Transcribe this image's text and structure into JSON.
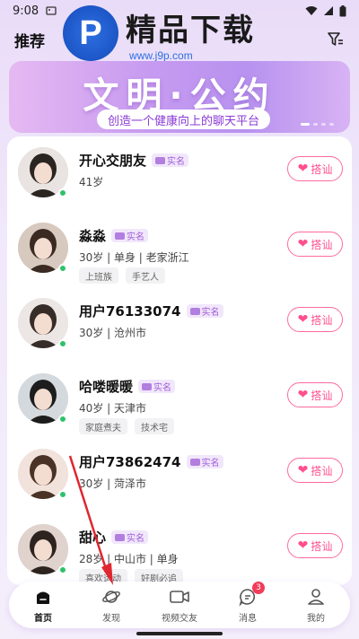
{
  "status_bar": {
    "time": "9:08"
  },
  "header": {
    "title": "推荐"
  },
  "watermark": {
    "logo_letter": "P",
    "title": "精品下载",
    "url": "www.j9p.com"
  },
  "banner": {
    "title": "文明·公约",
    "subtitle": "创造一个健康向上的聊天平台"
  },
  "verified_label": "实名",
  "chat_button_label": "搭讪",
  "users": [
    {
      "name": "开心交朋友",
      "meta": "41岁",
      "tags": []
    },
    {
      "name": "淼淼",
      "meta": "30岁 | 单身 | 老家浙江",
      "tags": [
        "上班族",
        "手艺人"
      ]
    },
    {
      "name": "用户76133074",
      "meta": "30岁 | 沧州市",
      "tags": []
    },
    {
      "name": "哈喽暖暖",
      "meta": "40岁 | 天津市",
      "tags": [
        "家庭煮夫",
        "技术宅"
      ]
    },
    {
      "name": "用户73862474",
      "meta": "30岁 | 菏泽市",
      "tags": []
    },
    {
      "name": "甜心",
      "meta": "28岁 | 中山市 | 单身",
      "tags": [
        "喜欢运动",
        "好剧必追"
      ]
    }
  ],
  "bottom_nav": {
    "items": [
      {
        "label": "首页",
        "icon": "home-icon"
      },
      {
        "label": "发现",
        "icon": "planet-icon"
      },
      {
        "label": "视频交友",
        "icon": "video-icon"
      },
      {
        "label": "消息",
        "icon": "message-icon"
      },
      {
        "label": "我的",
        "icon": "profile-icon"
      }
    ],
    "message_badge": "3"
  },
  "colors": {
    "accent_pink": "#ff4f8e",
    "verified_purple": "#a05fd8",
    "online_green": "#2ec26a",
    "banner_purple": "#c79bf0",
    "annotation_arrow": "#e0262f"
  }
}
